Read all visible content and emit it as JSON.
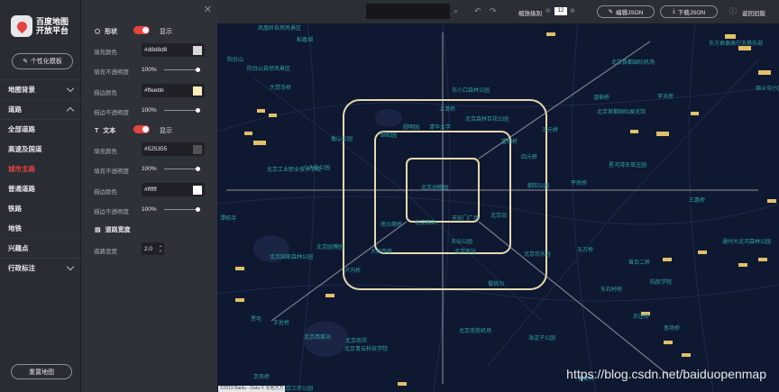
{
  "sidebar": {
    "logo_text": "百度地图\n开放平台",
    "template_button": "个性化模板",
    "items": [
      {
        "label": "地图背景",
        "chevron": "down"
      },
      {
        "label": "道路",
        "chevron": "up"
      },
      {
        "label": "全部道路"
      },
      {
        "label": "高速及国道"
      },
      {
        "label": "城市主路",
        "active": true
      },
      {
        "label": "普通道路"
      },
      {
        "label": "铁路"
      },
      {
        "label": "地铁"
      },
      {
        "label": "兴趣点"
      },
      {
        "label": "行政标注",
        "chevron": "down"
      }
    ],
    "reset_button": "重置地图",
    "accent_color": "#e5433e"
  },
  "panel": {
    "shape_title": "形状",
    "shape_toggle": "显示",
    "fill_color_label": "填充颜色",
    "fill_color_value": "#d8d8d8",
    "fill_opacity_label": "填充不透明度",
    "fill_opacity_value": "100%",
    "stroke_color_label": "描边颜色",
    "stroke_color_value": "#ffeebb",
    "stroke_opacity_label": "描边不透明度",
    "stroke_opacity_value": "100%",
    "text_title": "文本",
    "text_toggle": "显示",
    "text_fill_label": "填充颜色",
    "text_fill_value": "#525355",
    "text_fill_opacity_label": "填充不透明度",
    "text_fill_opacity_value": "100%",
    "text_stroke_label": "描边颜色",
    "text_stroke_value": "#ffffff",
    "text_stroke_opacity_label": "描边不透明度",
    "text_stroke_opacity_value": "100%",
    "width_title": "道路宽度",
    "width_label": "道路宽度",
    "width_value": "2.0"
  },
  "topbar": {
    "zoom_label": "缩放级别",
    "zoom_value": "12",
    "edit_json": "编辑JSON",
    "download_json": "下载JSON",
    "back_label": "返回旧版"
  },
  "map": {
    "places": [
      "凤凰岭自然风景区",
      "稻香湖",
      "阳台山",
      "阳台山自然风景区",
      "大觉寺桥",
      "东小口森林公园",
      "北京首都国际机场",
      "东方君泰高尔夫俱乐部",
      "温榆桥",
      "李天桥",
      "顺义屯小区",
      "上清桥",
      "香山公园",
      "颐和园",
      "圆明园",
      "清华大学",
      "北京森林百花公园",
      "望和桥",
      "五元桥",
      "北京首都国际展览馆",
      "八大处公园",
      "北京工业职业技术学院",
      "北京动物园",
      "四元桥",
      "朝阳公园",
      "平房桥",
      "星河湾东草庄园",
      "潭柘寺",
      "南沙窝桥",
      "天安门广场",
      "北京站",
      "三惠桥",
      "北京西站",
      "北京园博园",
      "天坛公园",
      "五方桥",
      "通州大运河森林公园",
      "大井西桥",
      "北京南站",
      "北京欢乐谷",
      "北京国家森林公园",
      "卢沟桥",
      "曾合二桥",
      "陆航学院",
      "樱桃沟",
      "东石村桥",
      "贾宅",
      "王佐桥",
      "北京西客站",
      "北京南苑机场",
      "北京南郊",
      "亦庄桥",
      "北京青云科技学院",
      "海淀子公园",
      "京良桥",
      "北京三环公园",
      "宽场桥",
      "郭家林"
    ],
    "watermark": "https://blog.csdn.net/baiduopenmap",
    "copyright": "©2019 Baidu - Data © 长地万方"
  }
}
